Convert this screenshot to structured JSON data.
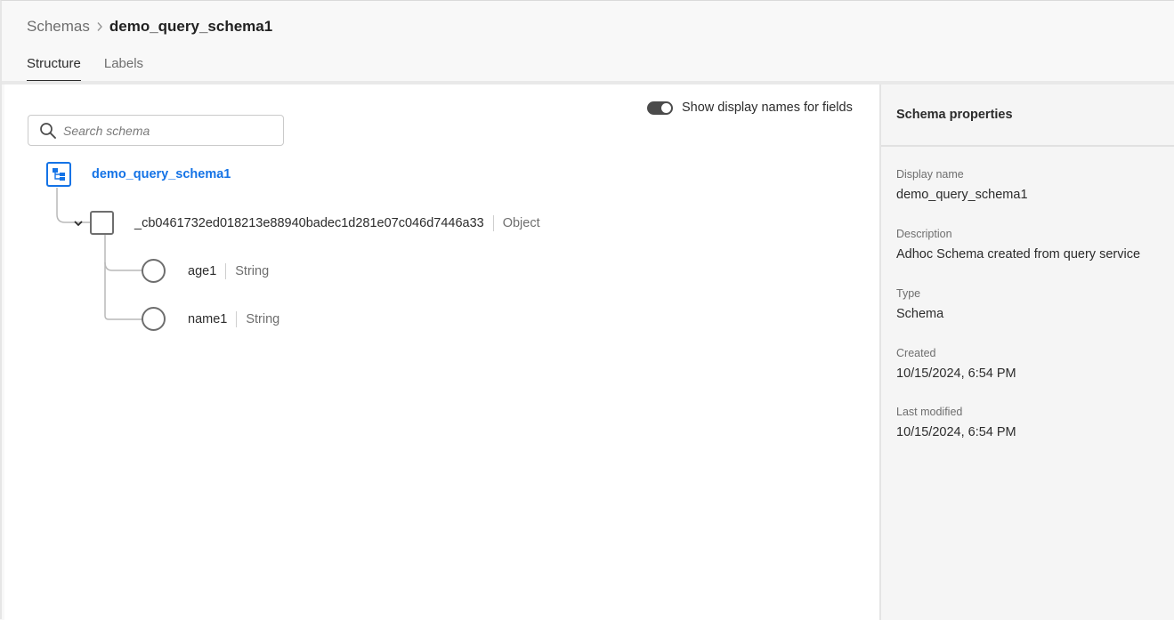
{
  "breadcrumb": {
    "root": "Schemas",
    "current": "demo_query_schema1"
  },
  "tabs": [
    {
      "label": "Structure",
      "active": true
    },
    {
      "label": "Labels",
      "active": false
    }
  ],
  "search": {
    "placeholder": "Search schema",
    "value": ""
  },
  "toggle": {
    "label": "Show display names for fields",
    "on": true
  },
  "tree": {
    "root": {
      "label": "demo_query_schema1",
      "icon": "schema-tree-icon"
    },
    "object": {
      "name": "_cb0461732ed018213e88940badec1d281e07c046d7446a33",
      "type": "Object",
      "expanded": true
    },
    "fields": [
      {
        "name": "age1",
        "type": "String"
      },
      {
        "name": "name1",
        "type": "String"
      }
    ]
  },
  "panel": {
    "title": "Schema properties",
    "display_name_label": "Display name",
    "display_name": "demo_query_schema1",
    "description_label": "Description",
    "description": "Adhoc Schema created from query service",
    "type_label": "Type",
    "type": "Schema",
    "created_label": "Created",
    "created": "10/15/2024, 6:54 PM",
    "modified_label": "Last modified",
    "modified": "10/15/2024, 6:54 PM"
  },
  "colors": {
    "accent": "#1473e6",
    "toggle_on": "#4b4b4b",
    "text": "#2c2c2c",
    "muted": "#6e6e6e"
  }
}
